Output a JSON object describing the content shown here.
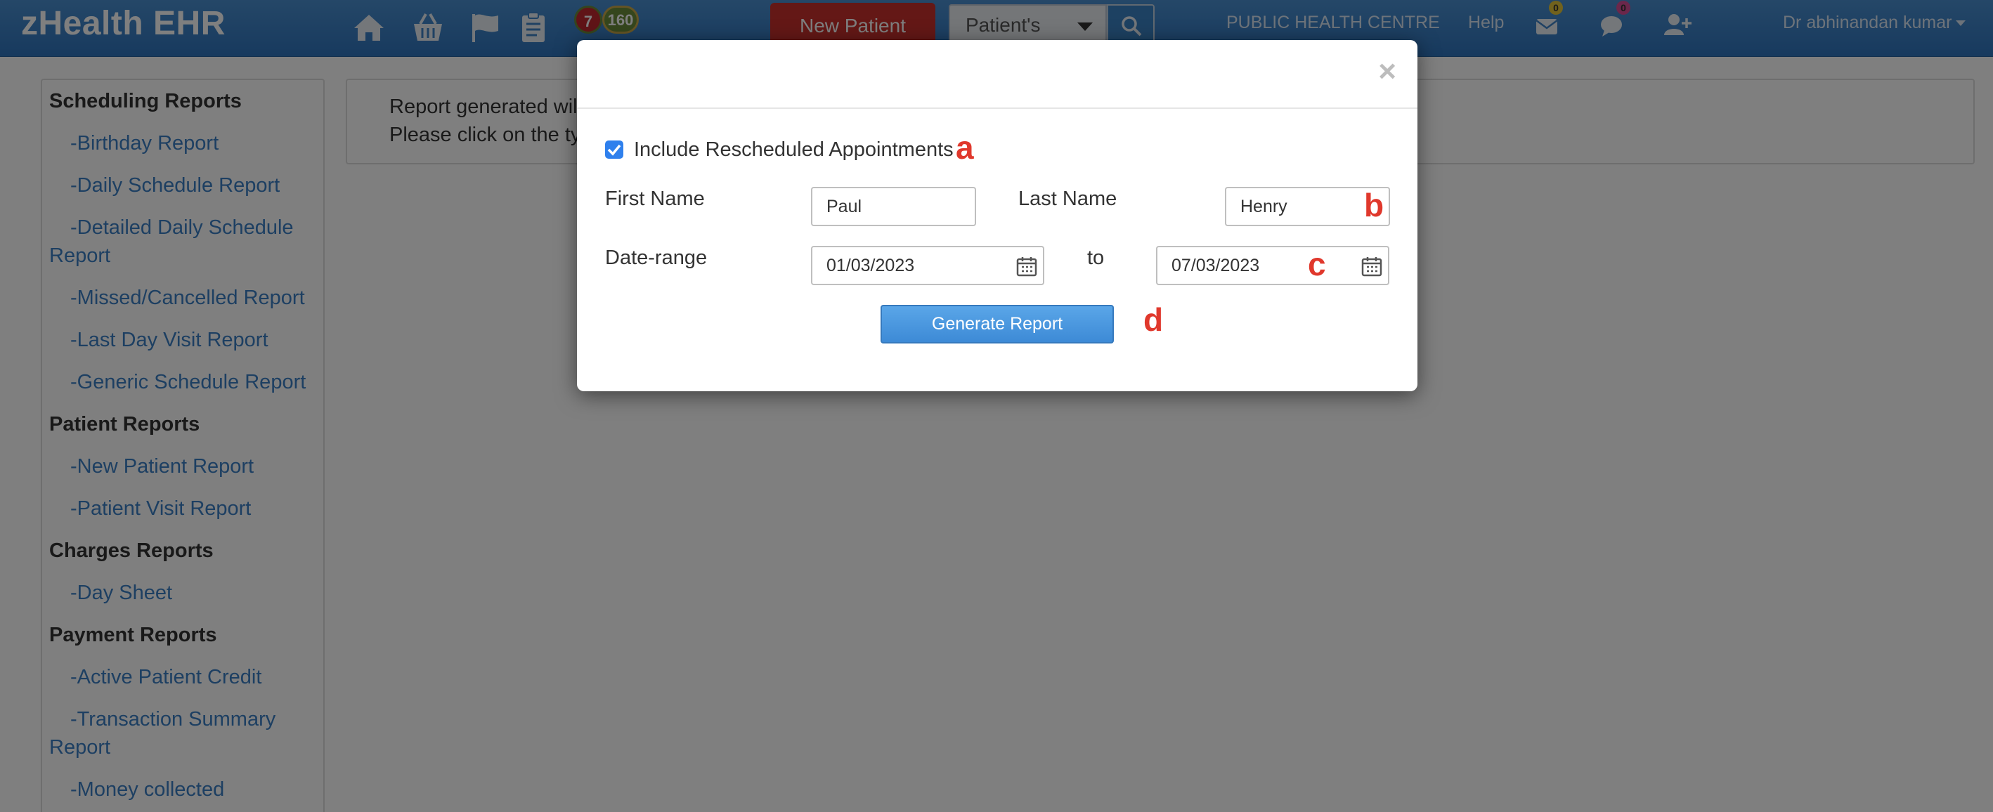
{
  "navbar": {
    "brand": "zHealth EHR",
    "icons": [
      "home-icon",
      "basket-icon",
      "flag-icon",
      "clipboard-icon"
    ],
    "badge_red": "7",
    "badge_green": "160",
    "new_patient_label": "New Patient",
    "patient_select_value": "Patient's",
    "centre": "PUBLIC HEALTH CENTRE",
    "help": "Help",
    "mail_count": "0",
    "chat_count": "0",
    "user": "Dr abhinandan kumar",
    "colors": {
      "bar": "#2f74bd",
      "new_patient": "#c9302c"
    }
  },
  "sidebar": {
    "sections": [
      {
        "title": "Scheduling Reports",
        "items": [
          "-Birthday Report",
          "-Daily Schedule Report",
          "-Detailed Daily Schedule Report",
          "-Missed/Cancelled Report",
          "-Last Day Visit Report",
          "-Generic Schedule Report"
        ]
      },
      {
        "title": "Patient Reports",
        "items": [
          "-New Patient Report",
          "-Patient Visit Report"
        ]
      },
      {
        "title": "Charges Reports",
        "items": [
          "-Day Sheet"
        ]
      },
      {
        "title": "Payment Reports",
        "items": [
          "-Active Patient Credit",
          "-Transaction Summary Report",
          "-Money collected"
        ]
      }
    ]
  },
  "info": {
    "line1": "Report generated will",
    "line2": "Please click on the ty"
  },
  "modal": {
    "close": "×",
    "include_rescheduled_label": "Include Rescheduled Appointments",
    "include_rescheduled_checked": true,
    "first_name_label": "First Name",
    "first_name_value": "Paul",
    "last_name_label": "Last Name",
    "last_name_value": "Henry",
    "date_range_label": "Date-range",
    "date_from": "01/03/2023",
    "to_label": "to",
    "date_to": "07/03/2023",
    "generate_label": "Generate Report",
    "annotations": {
      "a": "a",
      "b": "b",
      "c": "c",
      "d": "d"
    },
    "colors": {
      "annotation": "#e0382c",
      "button": "#3d8ad6"
    }
  }
}
